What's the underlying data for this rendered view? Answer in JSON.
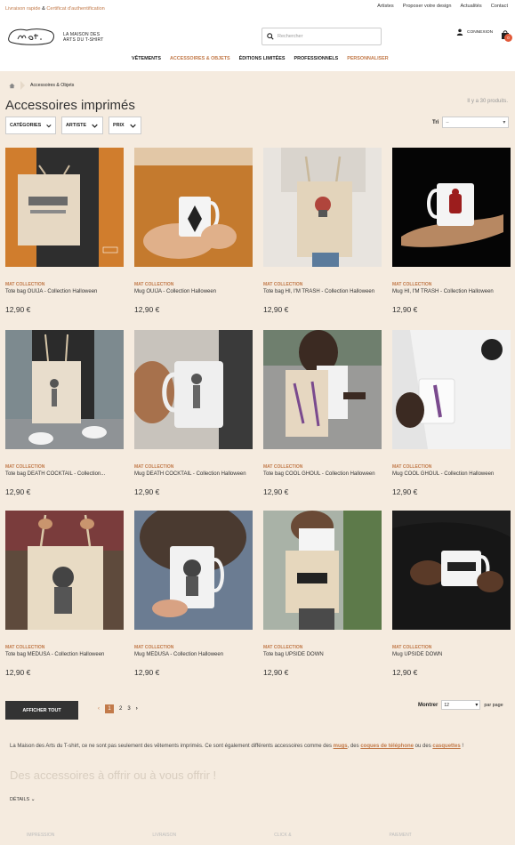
{
  "topbar": {
    "left_a": "Livraison rapide",
    "left_amp": "&",
    "left_b": "Certificat d'authentification",
    "links": [
      "Artistes",
      "Proposer votre design",
      "Actualités",
      "Contact"
    ]
  },
  "header": {
    "brand_line1": "LA MAISON DES",
    "brand_line2": "ARTS DU T-SHIRT",
    "search_placeholder": "Rechercher",
    "account_label": "CONNEXION",
    "cart_count": "0"
  },
  "nav": [
    "VÊTEMENTS",
    "ACCESSOIRES & OBJETS",
    "ÉDITIONS LIMITÉES",
    "PROFESSIONNELS",
    "PERSONNALISER"
  ],
  "breadcrumb": {
    "current": "Accessoires & Objets"
  },
  "page": {
    "title": "Accessoires imprimés",
    "count": "Il y a 30 produits.",
    "filters": [
      "CATÉGORIES",
      "ARTISTE",
      "PRIX"
    ],
    "sort_label": "Tri",
    "sort_value": "--"
  },
  "products": [
    {
      "collection": "MAT COLLECTION",
      "name": "Tote bag OUIJA - Collection Halloween",
      "price": "12,90 €",
      "image": "tote-ouija"
    },
    {
      "collection": "MAT COLLECTION",
      "name": "Mug OUIJA - Collection Halloween",
      "price": "12,90 €",
      "image": "mug-ouija"
    },
    {
      "collection": "MAT COLLECTION",
      "name": "Tote bag HI, I'M TRASH - Collection Halloween",
      "price": "12,90 €",
      "image": "tote-trash"
    },
    {
      "collection": "MAT COLLECTION",
      "name": "Mug HI, I'M TRASH - Collection Halloween",
      "price": "12,90 €",
      "image": "mug-trash"
    },
    {
      "collection": "MAT COLLECTION",
      "name": "Tote bag DEATH COCKTAIL - Collection...",
      "price": "12,90 €",
      "image": "tote-death"
    },
    {
      "collection": "MAT COLLECTION",
      "name": "Mug DEATH COCKTAIL - Collection Halloween",
      "price": "12,90 €",
      "image": "mug-death"
    },
    {
      "collection": "MAT COLLECTION",
      "name": "Tote bag COOL GHOUL - Collection Halloween",
      "price": "12,90 €",
      "image": "tote-ghoul"
    },
    {
      "collection": "MAT COLLECTION",
      "name": "Mug COOL GHOUL - Collection Halloween",
      "price": "12,90 €",
      "image": "mug-ghoul"
    },
    {
      "collection": "MAT COLLECTION",
      "name": "Tote bag MEDUSA - Collection Halloween",
      "price": "12,90 €",
      "image": "tote-medusa"
    },
    {
      "collection": "MAT COLLECTION",
      "name": "Mug MEDUSA - Collection Halloween",
      "price": "12,90 €",
      "image": "mug-medusa"
    },
    {
      "collection": "MAT COLLECTION",
      "name": "Tote bag UPSIDE DOWN",
      "price": "12,90 €",
      "image": "tote-upside"
    },
    {
      "collection": "MAT COLLECTION",
      "name": "Mug UPSIDE DOWN",
      "price": "12,90 €",
      "image": "mug-upside"
    }
  ],
  "listing": {
    "show_all": "AFFICHER TOUT",
    "pages": [
      "1",
      "2",
      "3"
    ],
    "current_page": "1",
    "show_label": "Montrer",
    "per_page_value": "12",
    "per_page_suffix": "par page"
  },
  "description": {
    "text_a": "La Maison des Arts du T-shirt, ce ne sont pas seulement des vêtements imprimés. Ce sont également différents accessoires comme des ",
    "link_mugs": "mugs",
    "text_b": ", des ",
    "link_coques": "coques de téléphone",
    "text_c": " ou des ",
    "link_casquettes": "casquettes",
    "text_d": " !",
    "heading": "Des accessoires à offrir ou à vous offrir !",
    "details": "DÉTAILS"
  },
  "footer": [
    "IMPRESSION",
    "LIVRAISON",
    "CLICK &",
    "PAIEMENT"
  ],
  "colors": {
    "accent": "#c27a4a",
    "background": "#f5ebdf",
    "dark_button": "#333333",
    "cart_badge": "#e25b3b"
  }
}
